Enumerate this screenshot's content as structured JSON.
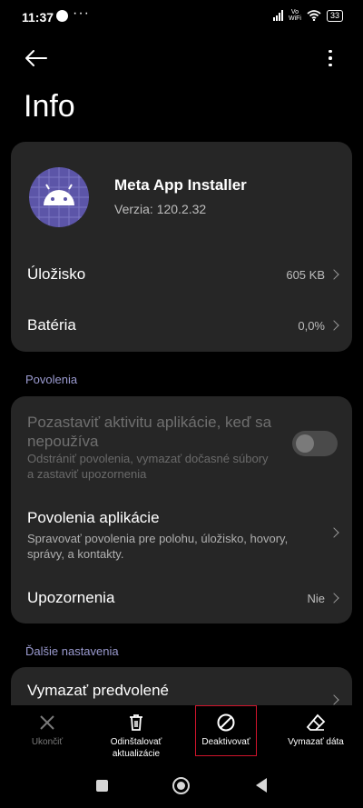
{
  "status_bar": {
    "time": "11:37",
    "dots": "···",
    "volte_top": "Vo",
    "volte_bottom": "WiFi",
    "battery": "33"
  },
  "page": {
    "title": "Info"
  },
  "app": {
    "name": "Meta App Installer",
    "version": "Verzia: 120.2.32"
  },
  "storage": {
    "label": "Úložisko",
    "value": "605 KB"
  },
  "battery_row": {
    "label": "Batéria",
    "value": "0,0%"
  },
  "permissions_section": {
    "header": "Povolenia",
    "pause": {
      "title_line1": "Pozastaviť aktivitu aplikácie, keď sa",
      "title_line2": "nepoužíva",
      "subtitle_line1": "Odstrániť povolenia, vymazať dočasné súbory",
      "subtitle_line2": "a zastaviť upozornenia",
      "enabled": false
    },
    "app_permissions": {
      "title": "Povolenia aplikácie",
      "subtitle_line1": "Spravovať povolenia pre polohu, úložisko, hovory,",
      "subtitle_line2": "správy, a kontakty."
    },
    "notifications": {
      "title": "Upozornenia",
      "value": "Nie"
    }
  },
  "other_section": {
    "header": "Ďalšie nastavenia",
    "clear_defaults": {
      "title": "Vymazať predvolené"
    }
  },
  "actions": {
    "force_stop": "Ukončiť",
    "uninstall_updates_line1": "Odinštalovať",
    "uninstall_updates_line2": "aktualizácie",
    "deactivate": "Deaktivovať",
    "clear_data": "Vymazať dáta"
  },
  "colors": {
    "accent": "#9b9bd0",
    "card": "#262626",
    "highlight": "#d0142c",
    "app_icon_bg": "#5c55a8"
  }
}
